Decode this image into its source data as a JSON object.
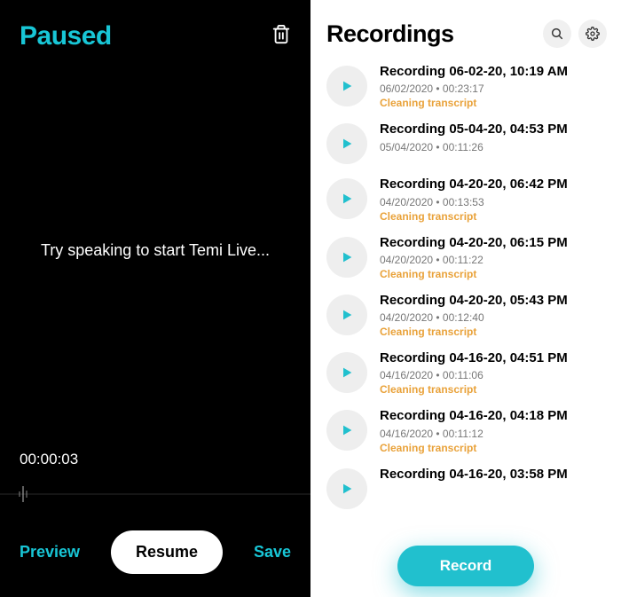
{
  "left": {
    "status": "Paused",
    "prompt": "Try speaking to start Temi Live...",
    "timer": "00:00:03",
    "preview_label": "Preview",
    "resume_label": "Resume",
    "save_label": "Save"
  },
  "right": {
    "title": "Recordings",
    "record_button": "Record",
    "items": [
      {
        "title": "Recording 06-02-20, 10:19 AM",
        "sub": "06/02/2020 • 00:23:17",
        "status": "Cleaning transcript"
      },
      {
        "title": "Recording 05-04-20, 04:53 PM",
        "sub": "05/04/2020 • 00:11:26",
        "status": ""
      },
      {
        "title": "Recording 04-20-20, 06:42 PM",
        "sub": "04/20/2020 • 00:13:53",
        "status": "Cleaning transcript"
      },
      {
        "title": "Recording 04-20-20, 06:15 PM",
        "sub": "04/20/2020 • 00:11:22",
        "status": "Cleaning transcript"
      },
      {
        "title": "Recording 04-20-20, 05:43 PM",
        "sub": "04/20/2020 • 00:12:40",
        "status": "Cleaning transcript"
      },
      {
        "title": "Recording 04-16-20, 04:51 PM",
        "sub": "04/16/2020 • 00:11:06",
        "status": "Cleaning transcript"
      },
      {
        "title": "Recording 04-16-20, 04:18 PM",
        "sub": "04/16/2020 • 00:11:12",
        "status": "Cleaning transcript"
      },
      {
        "title": "Recording 04-16-20, 03:58 PM",
        "sub": "",
        "status": ""
      }
    ]
  }
}
